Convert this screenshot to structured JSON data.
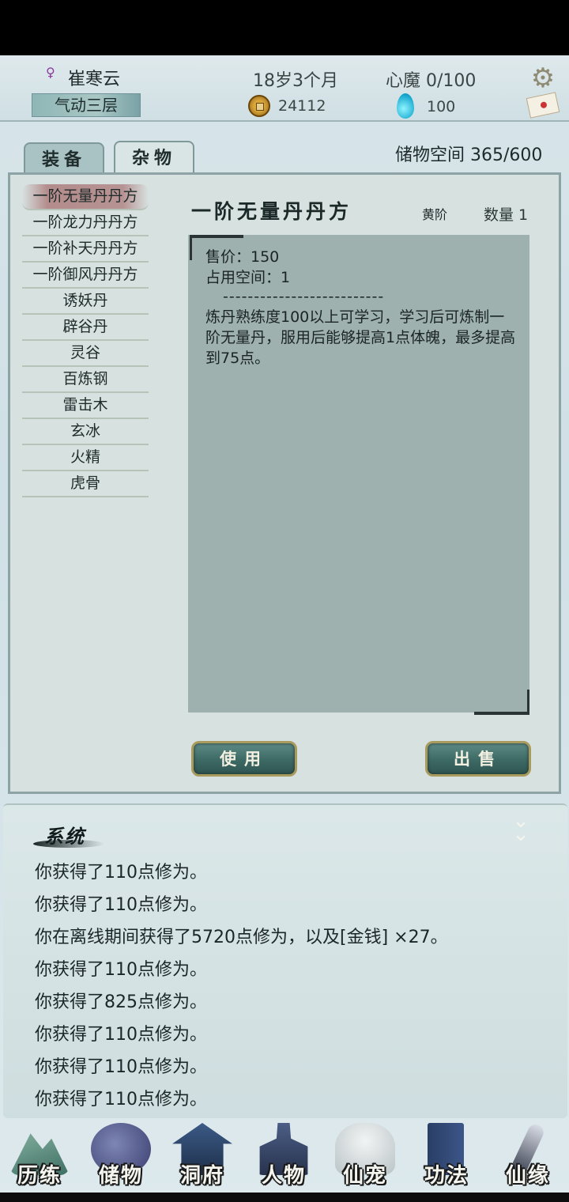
{
  "header": {
    "gender_icon": "♀",
    "name": "崔寒云",
    "realm": "气动三层",
    "age": "18岁3个月",
    "demon": "心魔  0/100",
    "coins": "24112",
    "gems": "100",
    "coin_icon": "copper-coin-icon",
    "gem_icon": "spirit-drop-icon"
  },
  "tabs": {
    "equip": "装备",
    "misc": "杂物"
  },
  "storage": "储物空间 365/600",
  "items": [
    "一阶无量丹丹方",
    "一阶龙力丹丹方",
    "一阶补天丹丹方",
    "一阶御风丹丹方",
    "诱妖丹",
    "辟谷丹",
    "灵谷",
    "百炼钢",
    "雷击木",
    "玄冰",
    "火精",
    "虎骨"
  ],
  "detail": {
    "title": "一阶无量丹丹方",
    "grade": "黄阶",
    "qty_label": "数量",
    "qty": "1",
    "price": "售价：150",
    "space": "占用空间：1",
    "divider": "--------------------------",
    "desc": "炼丹熟练度100以上可学习，学习后可炼制一阶无量丹，服用后能够提高1点体魄，最多提高到75点。"
  },
  "buttons": {
    "use": "使用",
    "sell": "出售"
  },
  "log": {
    "title": "系统",
    "lines": [
      "你获得了110点修为。",
      "你获得了110点修为。",
      "你在离线期间获得了5720点修为，以及[金钱] ×27。",
      "你获得了110点修为。",
      "你获得了825点修为。",
      "你获得了110点修为。",
      "你获得了110点修为。",
      "你获得了110点修为。"
    ]
  },
  "nav": [
    "历练",
    "储物",
    "洞府",
    "人物",
    "仙宠",
    "功法",
    "仙缘"
  ],
  "colors": {
    "panel": "#d7e1e0",
    "detail_box": "#9fb1ae",
    "button": "#3d6965",
    "selected": "#a85a5a"
  }
}
